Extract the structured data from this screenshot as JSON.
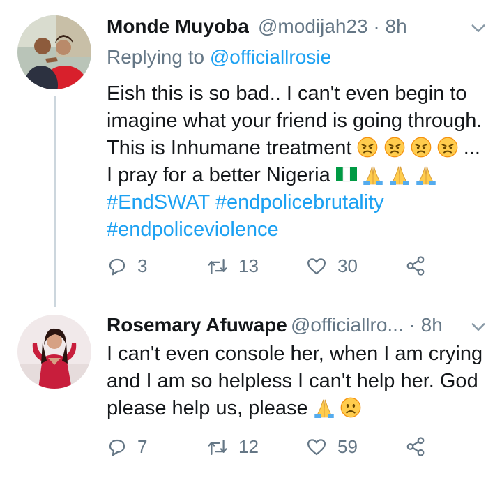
{
  "tweets": [
    {
      "display_name": "Monde Muyoba",
      "handle": "@modijah23",
      "time": "· 8h",
      "replying_label": "Replying to",
      "replying_handle": "@officiallrosie",
      "text_parts": [
        "Eish this is so bad.. I can't even begin to imagine what your friend is going through. This is Inhumane treatment",
        "... I pray for a better Nigeria",
        "#EndSWAT",
        "#endpolicebrutality",
        "#endpoliceviolence"
      ],
      "replies": "3",
      "retweets": "13",
      "likes": "30"
    },
    {
      "display_name": "Rosemary Afuwape",
      "handle": "@officiallro...",
      "time": "· 8h",
      "text": "I can't even console her, when I am crying and I am so helpless I can't help her. God please help us, please",
      "replies": "7",
      "retweets": "12",
      "likes": "59"
    }
  ],
  "icons": {
    "reply": "reply-icon",
    "retweet": "retweet-icon",
    "like": "heart-icon",
    "share": "share-icon",
    "caret": "chevron-down-icon"
  },
  "colors": {
    "link": "#1da1f2",
    "secondary": "#657786",
    "text": "#14171a",
    "divider": "#e6ecf0"
  }
}
